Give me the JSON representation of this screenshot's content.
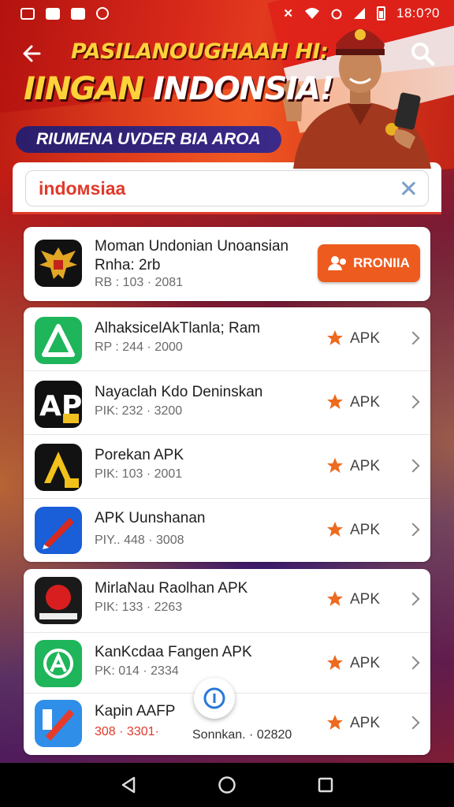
{
  "status_bar": {
    "time": "18:0?0",
    "left_icons": [
      "photo-icon",
      "message-icon",
      "play-icon",
      "chat-icon"
    ],
    "right_icons": [
      "mute-icon",
      "wifi-icon",
      "alarm-icon",
      "signal-icon",
      "battery-icon"
    ]
  },
  "hero": {
    "line1": "PASILANOUGHAAH HI:",
    "line2_yellow": "IINGAN",
    "line2_white": " INDONSIA!",
    "pill": "RIUMENA UVDER BIA AROA"
  },
  "search": {
    "value": "indoмsiaa"
  },
  "featured_app": {
    "name_line1": "Moman Undonian Unoansian",
    "name_line2": "Rnha: 2rb",
    "meta": "RB : 103 · 2081",
    "install_label": "RRONIIA",
    "icon": "garuda-icon"
  },
  "apps_group1": [
    {
      "name": "AlhaksicelAkTlanla; Ram",
      "meta": "RP : 244 · 2000",
      "badge": "APK",
      "icon": "triangle-green-icon"
    },
    {
      "name": "Nayaclah Kdo Deninskan",
      "meta": "PIK: 232 · 3200",
      "badge": "APK",
      "icon": "ap-black-icon"
    },
    {
      "name": "Porekan APK",
      "meta": "PIK: 103 · 2001",
      "badge": "APK",
      "icon": "yellow-a-icon"
    },
    {
      "name": "APK Uunshanan",
      "meta": "PIY.. 448 · 3008",
      "badge": "APK",
      "icon": "blue-pen-icon"
    }
  ],
  "apps_group2": [
    {
      "name": "MirlaNau Raolhan APK",
      "meta": "PIK: 133 · 2263",
      "badge": "APK",
      "icon": "red-circle-icon"
    },
    {
      "name": "KanKcdaa Fangen APK",
      "meta": "PK: 014 · 2334",
      "badge": "APK",
      "icon": "green-a-icon"
    },
    {
      "name": "Kapin AAFP",
      "meta": "308 · 3301·",
      "badge": "APK",
      "icon": "blue-tools-icon"
    }
  ],
  "fab": {
    "caption": "Sonnkan. · 02820"
  },
  "colors": {
    "accent": "#ee5b1f",
    "hero_red": "#d92a1b",
    "star": "#ee6a1f",
    "search_text": "#e0392a"
  }
}
